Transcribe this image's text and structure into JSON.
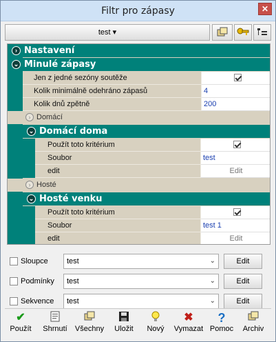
{
  "window": {
    "title": "Filtr pro zápasy",
    "close_glyph": "✕"
  },
  "toolbar": {
    "combo_label": "test ▾",
    "btn1_icon": "copy-icon",
    "btn2_icon": "key-icon",
    "btn3_icon": "tree-icon"
  },
  "grid": {
    "nastaveni": "Nastavení",
    "minule": "Minulé zápasy",
    "props_minule": [
      {
        "name": "Jen z jedné sezóny soutěže",
        "value": ""
      },
      {
        "name": "Kolik minimálně odehráno zápasů",
        "value": "4"
      },
      {
        "name": "Kolik dnů zpětně",
        "value": "200"
      }
    ],
    "domaci": "Domácí",
    "domaci_doma": "Domácí doma",
    "props_dd": [
      {
        "name": "Použít toto kritérium",
        "value": ""
      },
      {
        "name": "Soubor",
        "value": "test"
      },
      {
        "name": "edit",
        "value": "Edit"
      }
    ],
    "hoste": "Hosté",
    "hoste_venku": "Hosté venku",
    "props_hv": [
      {
        "name": "Použít toto kritérium",
        "value": ""
      },
      {
        "name": "Soubor",
        "value": "test 1"
      },
      {
        "name": "edit",
        "value": "Edit"
      }
    ]
  },
  "fields": [
    {
      "label": "Sloupce",
      "value": "test",
      "edit": "Edit"
    },
    {
      "label": "Podmínky",
      "value": "test",
      "edit": "Edit"
    },
    {
      "label": "Sekvence",
      "value": "test",
      "edit": "Edit"
    }
  ],
  "buttons": {
    "pouzit": "Použít",
    "shrnuti": "Shrnutí",
    "vsechny": "Všechny",
    "ulozit": "Uložit",
    "novy": "Nový",
    "vymazat": "Vymazat",
    "pomoc": "Pomoc",
    "archiv": "Archiv"
  },
  "colors": {
    "category": "#00817a",
    "grid_bg": "#d8d1c0",
    "value_text": "#1a3fb0"
  }
}
